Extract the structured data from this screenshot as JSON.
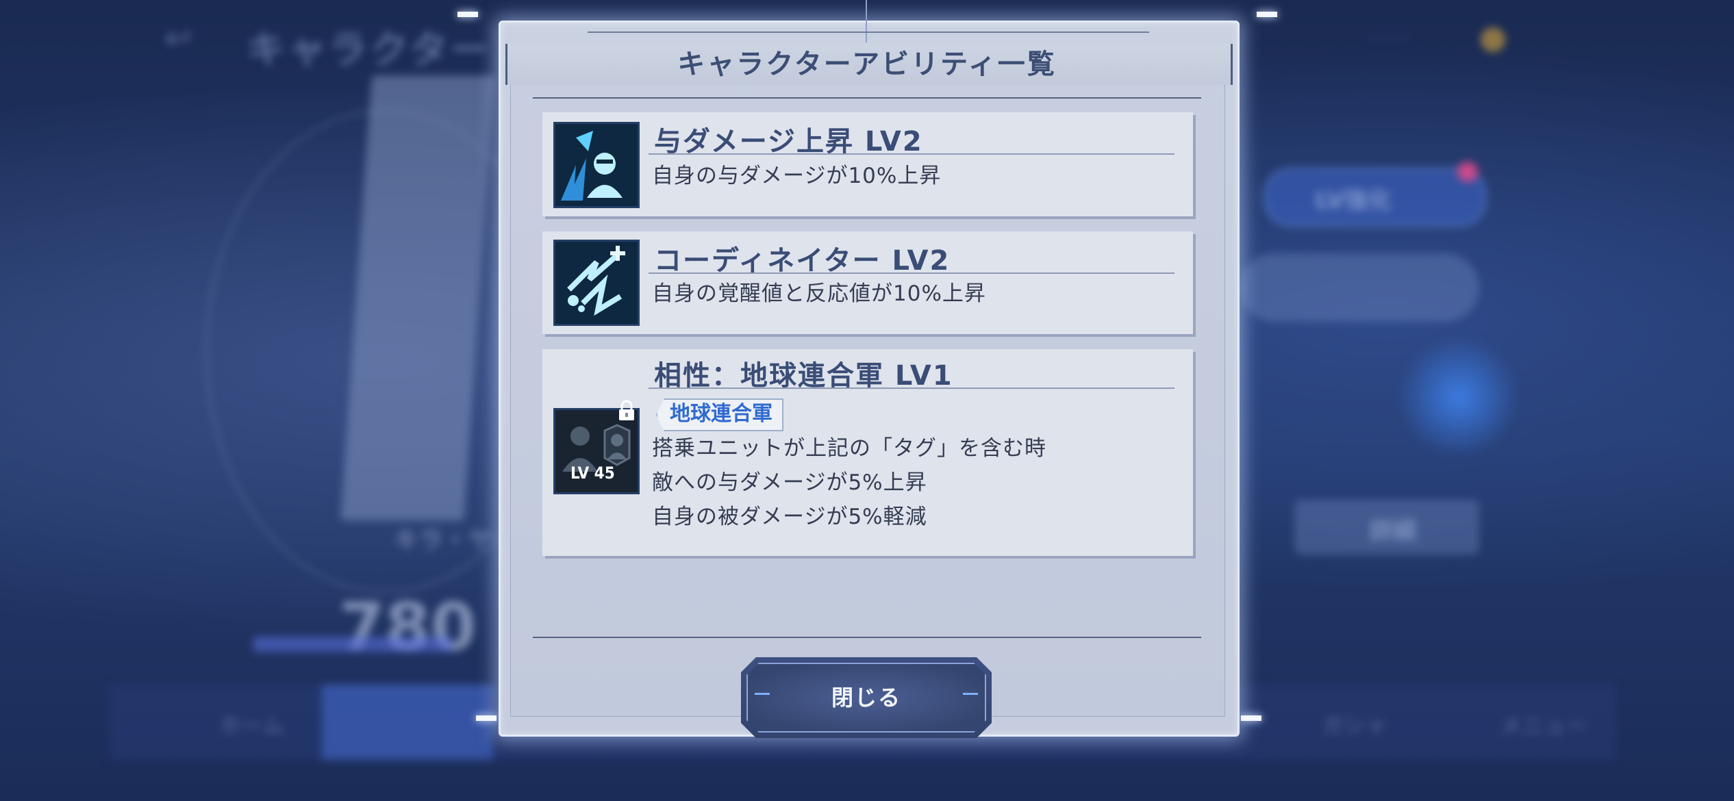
{
  "dialog": {
    "title": "キャラクターアビリティ一覧",
    "close_label": "閉じる"
  },
  "abilities": [
    {
      "name": "与ダメージ上昇 LV2",
      "description": "自身の与ダメージが10%上昇",
      "icon": "damage-up-icon"
    },
    {
      "name": "コーディネイター LV2",
      "description": "自身の覚醒値と反応値が10%上昇",
      "icon": "coordinator-icon"
    },
    {
      "name": "相性：地球連合軍 LV1",
      "tag": "地球連合軍",
      "description_lines": [
        "搭乗ユニットが上記の「タグ」を含む時",
        "敵への与ダメージが5%上昇",
        "自身の被ダメージが5%軽減"
      ],
      "icon": "affinity-locked-icon",
      "unlock_level": "LV 45",
      "locked": true
    }
  ],
  "background": {
    "title": "キャラクター",
    "score": "780",
    "character_name": "キラ・ヤ",
    "lv_button": "LV強化",
    "detail_button": "詳細",
    "nav_home": "ホーム",
    "nav_gacha": "ガシャ",
    "nav_menu": "メニュー"
  },
  "colors": {
    "title_text": "#3c4e74",
    "tag_text": "#2f6ad0",
    "icon_bg": "#0e2a45",
    "button_bg": "#3e5082"
  }
}
